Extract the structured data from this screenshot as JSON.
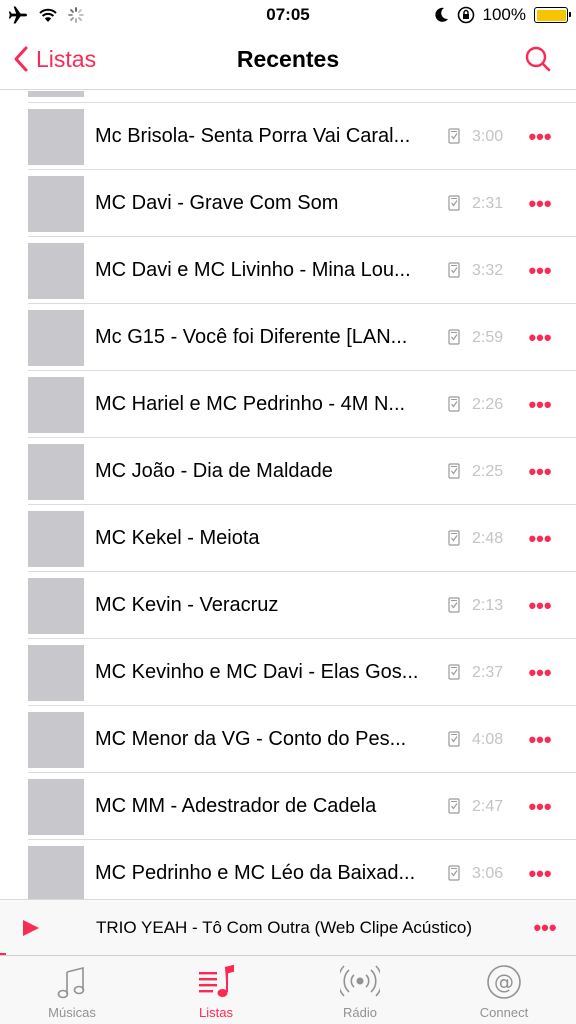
{
  "status_bar": {
    "time": "07:05",
    "battery_percent": "100%",
    "battery_color": "#f7c500",
    "icons": [
      "airplane-icon",
      "wifi-icon",
      "activity-spinner-icon",
      "moon-icon",
      "rotation-lock-icon",
      "battery-icon"
    ]
  },
  "nav": {
    "back_label": "Listas",
    "title": "Recentes",
    "search_icon": "search-icon",
    "accent_color": "#fb2a55"
  },
  "songs": [
    {
      "title": "Mc Brisola- Senta Porra Vai Caral...",
      "duration": "3:00"
    },
    {
      "title": "MC Davi - Grave Com Som",
      "duration": "2:31"
    },
    {
      "title": "MC Davi e MC Livinho - Mina Lou...",
      "duration": "3:32"
    },
    {
      "title": "Mc G15 - Você foi Diferente [LAN...",
      "duration": "2:59"
    },
    {
      "title": "MC Hariel e MC Pedrinho - 4M N...",
      "duration": "2:26"
    },
    {
      "title": "MC João - Dia de Maldade",
      "duration": "2:25"
    },
    {
      "title": "MC Kekel - Meiota",
      "duration": "2:48"
    },
    {
      "title": "MC Kevin - Veracruz",
      "duration": "2:13"
    },
    {
      "title": "MC Kevinho e MC Davi - Elas Gos...",
      "duration": "2:37"
    },
    {
      "title": "MC Menor da VG - Conto do Pes...",
      "duration": "4:08"
    },
    {
      "title": "MC MM - Adestrador de Cadela",
      "duration": "2:47"
    },
    {
      "title": "MC Pedrinho e MC Léo da Baixad...",
      "duration": "3:06"
    }
  ],
  "more_glyph": "•••",
  "now_playing": {
    "title": "TRIO YEAH - Tô Com Outra (Web Clipe Acústico)",
    "progress": 0.01
  },
  "tabs": [
    {
      "label": "Músicas",
      "icon": "music-note-icon",
      "active": false
    },
    {
      "label": "Listas",
      "icon": "playlist-icon",
      "active": true
    },
    {
      "label": "Rádio",
      "icon": "radio-icon",
      "active": false
    },
    {
      "label": "Connect",
      "icon": "connect-icon",
      "active": false
    }
  ]
}
